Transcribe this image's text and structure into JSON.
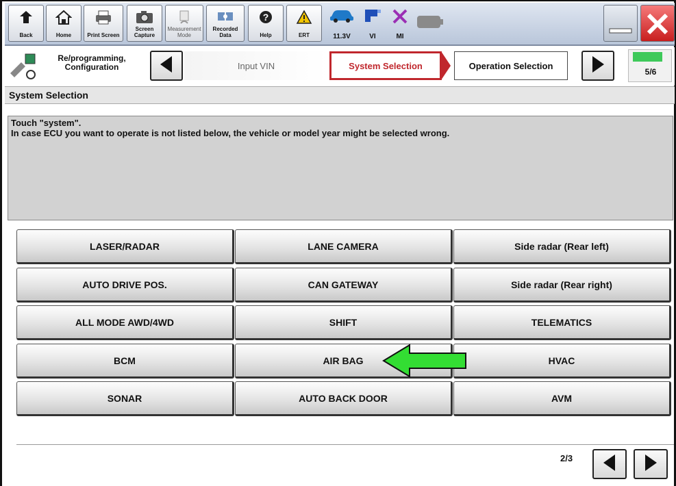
{
  "toolbar": {
    "back": "Back",
    "home": "Home",
    "print_screen": "Print Screen",
    "screen_capture": "Screen Capture",
    "measurement_mode": "Measurement Mode",
    "recorded_data": "Recorded Data",
    "help": "Help",
    "ert": "ERT",
    "voltage": "11.3V",
    "vi": "VI",
    "mi": "MI"
  },
  "nav": {
    "mode_title": "Re/programming, Configuration",
    "steps": [
      "Input VIN",
      "System Selection",
      "Operation Selection"
    ],
    "active_step": "System Selection",
    "progress_text": "5/6",
    "progress_fraction": 0.833
  },
  "page": {
    "section_title": "System Selection",
    "instruction_line1": "Touch \"system\".",
    "instruction_line2": "In case ECU you want to operate is not listed below, the vehicle or model year might be selected wrong."
  },
  "systems": [
    [
      "LASER/RADAR",
      "LANE CAMERA",
      "Side radar (Rear left)"
    ],
    [
      "AUTO DRIVE POS.",
      "CAN GATEWAY",
      "Side radar (Rear right)"
    ],
    [
      "ALL MODE AWD/4WD",
      "SHIFT",
      "TELEMATICS"
    ],
    [
      "BCM",
      "AIR BAG",
      "HVAC"
    ],
    [
      "SONAR",
      "AUTO BACK DOOR",
      "AVM"
    ]
  ],
  "pager": {
    "text": "2/3"
  },
  "colors": {
    "active_step_border": "#c0272d",
    "progress_green": "#3ec95a",
    "close_red": "#e23b3b",
    "arrow_green": "#33dd33"
  }
}
